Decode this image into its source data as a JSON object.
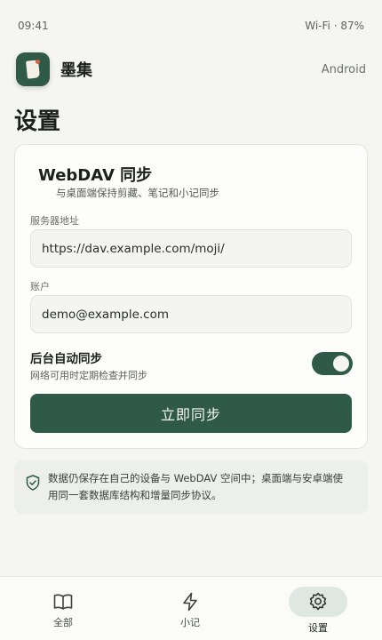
{
  "status_bar": {
    "time": "09:41",
    "connectivity": "Wi-Fi · 87%"
  },
  "header": {
    "app_name": "墨集",
    "platform": "Android",
    "logo_icon": "book-icon"
  },
  "page": {
    "title": "设置"
  },
  "webdav": {
    "title": "WebDAV 同步",
    "subtitle": "与桌面端保持剪藏、笔记和小记同步",
    "server_label": "服务器地址",
    "server_value": "https://dav.example.com/moji/",
    "account_label": "账户",
    "account_value": "demo@example.com",
    "auto_sync_title": "后台自动同步",
    "auto_sync_desc": "网络可用时定期检查并同步",
    "auto_sync_enabled": true,
    "sync_button": "立即同步"
  },
  "notice": {
    "icon": "shield-icon",
    "text": "数据仍保存在自己的设备与 WebDAV 空间中；桌面端与安卓端使用同一套数据库结构和增量同步协议。"
  },
  "bottom_nav": {
    "items": [
      {
        "label": "全部",
        "icon": "book-open-icon",
        "active": false
      },
      {
        "label": "小记",
        "icon": "lightning-icon",
        "active": false
      },
      {
        "label": "设置",
        "icon": "gear-icon",
        "active": true
      }
    ]
  },
  "colors": {
    "accent": "#2f5a48",
    "background": "#f5f5f1",
    "active_pill": "#dfe7e2"
  }
}
